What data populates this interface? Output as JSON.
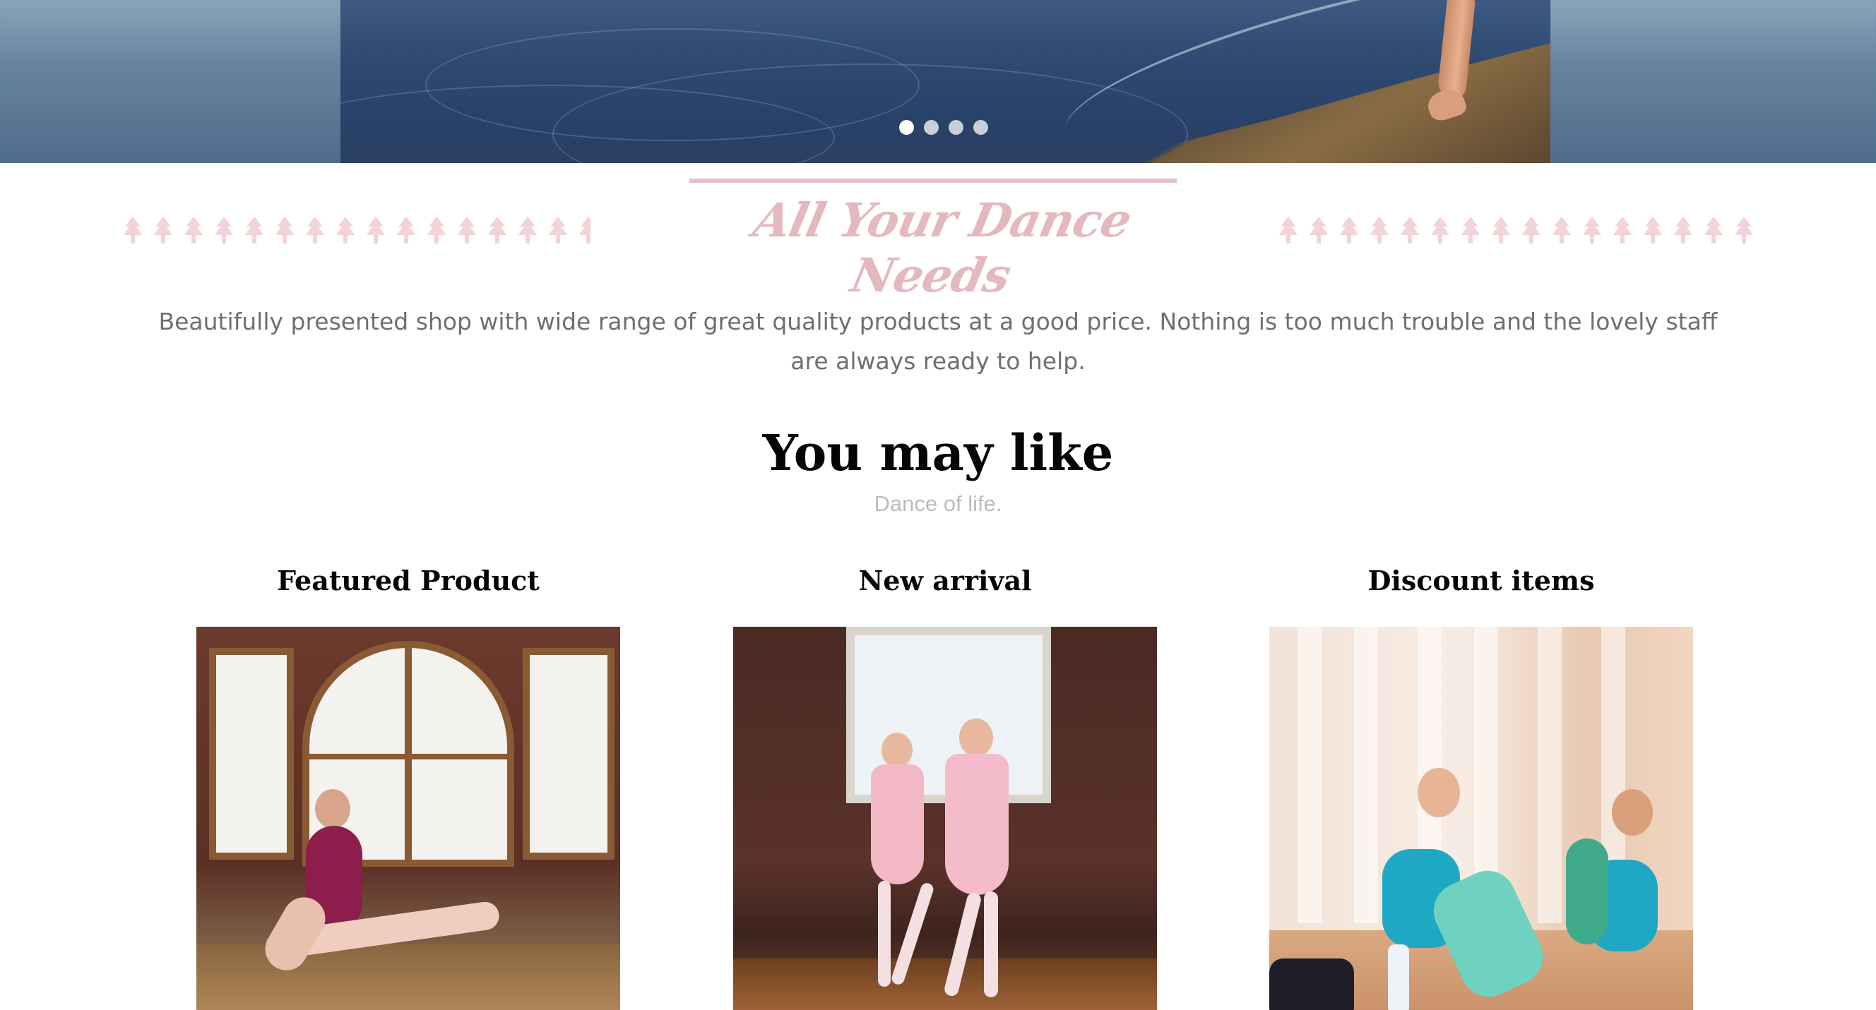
{
  "slider": {
    "dots": [
      {
        "label": "slide-1",
        "active": true
      },
      {
        "label": "slide-2",
        "active": false
      },
      {
        "label": "slide-3",
        "active": false
      },
      {
        "label": "slide-4",
        "active": false
      }
    ]
  },
  "intro": {
    "script_heading": "All Your Dance Needs",
    "description": "Beautifully presented shop with wide range of great quality products at a good price. Nothing is too much trouble and the lovely staff are always ready to help."
  },
  "section": {
    "title": "You may like",
    "subtitle": "Dance of life."
  },
  "products": [
    {
      "heading": "Featured Product",
      "image": "ballet dancer in burgundy leotard sitting by studio windows"
    },
    {
      "heading": "New arrival",
      "image": "two little ballerinas in pink dresses in studio"
    },
    {
      "heading": "Discount items",
      "image": "two dancers in teal leotards stretching with dance bag"
    }
  ],
  "colors": {
    "accent_pink": "#e3b9bf",
    "text_gray": "#6f6f6f",
    "subtitle_gray": "#bcbcbc"
  }
}
